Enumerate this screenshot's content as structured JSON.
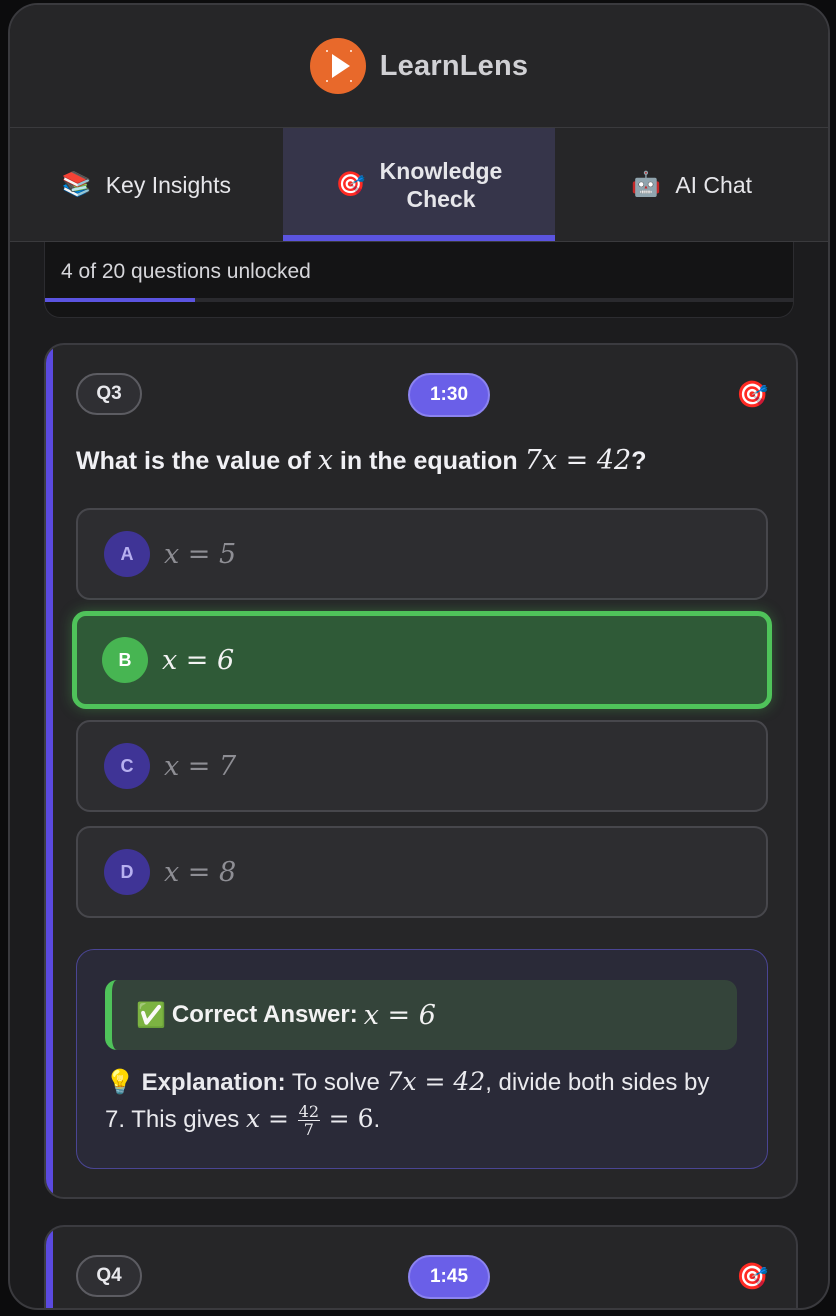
{
  "app": {
    "title": "LearnLens"
  },
  "tabs": [
    {
      "icon": "📚",
      "icon_name": "books-icon",
      "label": "Key Insights",
      "active": false
    },
    {
      "icon": "🎯",
      "icon_name": "target-icon",
      "label_line1": "Knowledge",
      "label_line2": "Check",
      "active": true
    },
    {
      "icon": "🤖",
      "icon_name": "robot-icon",
      "label": "AI Chat",
      "active": false
    }
  ],
  "progress": {
    "text": "4 of 20 questions unlocked",
    "unlocked": 4,
    "total": 20
  },
  "questions": [
    {
      "number": "Q3",
      "timer": "1:30",
      "prompt_prefix": "What is the value of",
      "prompt_var": "x",
      "prompt_mid": "in the equation",
      "prompt_eq": "7x = 42",
      "prompt_suffix": "?",
      "options": [
        {
          "letter": "A",
          "text": "x = 5"
        },
        {
          "letter": "B",
          "text": "x = 6",
          "correct": true
        },
        {
          "letter": "C",
          "text": "x = 7"
        },
        {
          "letter": "D",
          "text": "x = 8"
        }
      ],
      "feedback": {
        "answer_icon": "✅",
        "answer_label": "Correct Answer:",
        "answer_value": "x = 6",
        "explanation_icon": "💡",
        "explanation_label": "Explanation:",
        "explanation_part1": "To solve",
        "explanation_eq1": "7x = 42",
        "explanation_part2": ", divide both sides by 7. This gives",
        "explanation_eq2_left": "x =",
        "explanation_frac_num": "42",
        "explanation_frac_den": "7",
        "explanation_eq2_right": "= 6",
        "explanation_end": "."
      }
    },
    {
      "number": "Q4",
      "timer": "1:45"
    }
  ],
  "colors": {
    "accent": "#5b54e0",
    "brand": "#e8692b",
    "correct": "#4fc35a"
  }
}
